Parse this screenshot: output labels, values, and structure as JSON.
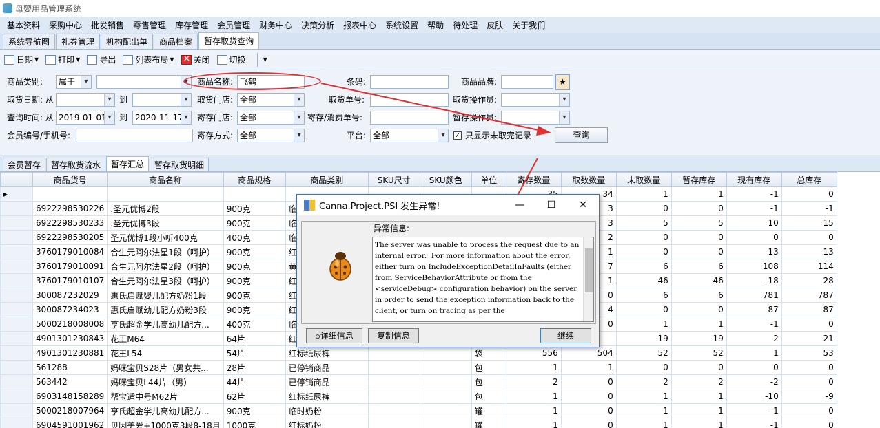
{
  "app_title": "母婴用品管理系统",
  "menu": [
    "基本资料",
    "采购中心",
    "批发销售",
    "零售管理",
    "库存管理",
    "会员管理",
    "财务中心",
    "决策分析",
    "报表中心",
    "系统设置",
    "帮助",
    "待处理",
    "皮肤",
    "关于我们"
  ],
  "doc_tabs": [
    "系统导航图",
    "礼券管理",
    "机构配出单",
    "商品档案",
    "暂存取货查询"
  ],
  "toolbar": {
    "date": "日期",
    "print": "打印",
    "export": "导出",
    "layout": "列表布局",
    "close": "关闭",
    "switch": "切换"
  },
  "filter": {
    "category_label": "商品类别:",
    "category_op": "属于",
    "category_value": "",
    "name_label": "商品名称:",
    "name_value": "飞鹤",
    "barcode_label": "条码:",
    "barcode_value": "",
    "brand_label": "商品品牌:",
    "brand_value": "",
    "pickup_date_label": "取货日期: 从",
    "pickup_from": "",
    "to1": "到",
    "pickup_to": "",
    "pickup_store_label": "取货门店:",
    "pickup_store": "全部",
    "pickup_no_label": "取货单号:",
    "pickup_no": "",
    "pickup_op_label": "取货操作员:",
    "pickup_op": "",
    "query_time_label": "查询时间: 从",
    "query_from": "2019-01-01",
    "to2": "到",
    "query_to": "2020-11-17",
    "deposit_store_label": "寄存门店:",
    "deposit_store": "全部",
    "deposit_no_label": "寄存/消费单号:",
    "deposit_no": "",
    "temp_op_label": "暂存操作员:",
    "temp_op": "",
    "member_label": "会员编号/手机号:",
    "member_value": "",
    "deposit_mode_label": "寄存方式:",
    "deposit_mode": "全部",
    "platform_label": "平台:",
    "platform": "全部",
    "only_unfinished_label": "只显示未取完记录",
    "only_unfinished_checked": true,
    "query_button": "查询"
  },
  "sub_tabs": [
    "会员暂存",
    "暂存取货流水",
    "暂存汇总",
    "暂存取货明细"
  ],
  "table": {
    "columns": [
      "商品货号",
      "商品名称",
      "商品规格",
      "商品类别",
      "SKU尺寸",
      "SKU颜色",
      "单位",
      "寄存数量",
      "取数数量",
      "未取数量",
      "暂存库存",
      "现有库存",
      "总库存"
    ],
    "summary": [
      "",
      "",
      "",
      "",
      "",
      "",
      "",
      "35",
      "34",
      "1",
      "1",
      "-1",
      "0"
    ],
    "rows": [
      [
        "6922298530226",
        ".圣元优博2段",
        "900克",
        "临时奶",
        "",
        "",
        "",
        "",
        "3",
        "0",
        "0",
        "-1",
        "-1"
      ],
      [
        "6922298530233",
        ".圣元优博3段",
        "900克",
        "临时奶",
        "",
        "",
        "",
        "",
        "3",
        "5",
        "5",
        "10",
        "15"
      ],
      [
        "6922298530205",
        "圣元优博1段小听400克",
        "400克",
        "临时奶",
        "",
        "",
        "",
        "",
        "2",
        "0",
        "0",
        "0",
        "0"
      ],
      [
        "3760179010084",
        "合生元阿尔法星1段（呵护）",
        "900克",
        "红标奶",
        "",
        "",
        "",
        "",
        "1",
        "0",
        "0",
        "13",
        "13"
      ],
      [
        "3760179010091",
        "合生元阿尔法星2段（呵护）",
        "900克",
        "黄标奶",
        "",
        "",
        "",
        "",
        "7",
        "6",
        "6",
        "108",
        "114"
      ],
      [
        "3760179010107",
        "合生元阿尔法星3段（呵护）",
        "900克",
        "红标奶",
        "",
        "",
        "",
        "",
        "1",
        "46",
        "46",
        "-18",
        "28"
      ],
      [
        "300087232029",
        "惠氏启赋婴儿配方奶粉1段",
        "900克",
        "红标奶",
        "",
        "",
        "",
        "",
        "0",
        "6",
        "6",
        "781",
        "787"
      ],
      [
        "300087234023",
        "惠氏启赋幼儿配方奶粉3段",
        "900克",
        "红标奶",
        "",
        "",
        "",
        "",
        "4",
        "0",
        "0",
        "87",
        "87"
      ],
      [
        "5000218008008",
        "亨氏超金学儿高幼儿配方...",
        "400克",
        "临时奶",
        "",
        "",
        "",
        "",
        "0",
        "1",
        "1",
        "-1",
        "0"
      ],
      [
        "4901301230843",
        "花王M64",
        "64片",
        "红标纸",
        "",
        "",
        "",
        "",
        "",
        "19",
        "19",
        "2",
        "21"
      ],
      [
        "4901301230881",
        "花王L54",
        "54片",
        "红标纸尿裤",
        "",
        "",
        "袋",
        "556",
        "504",
        "52",
        "52",
        "1",
        "53"
      ],
      [
        "561288",
        "妈咪宝贝S28片（男女共...",
        "28片",
        "已停销商品",
        "",
        "",
        "包",
        "1",
        "1",
        "0",
        "0",
        "0",
        "0"
      ],
      [
        "563442",
        "妈咪宝贝L44片（男）",
        "44片",
        "已停销商品",
        "",
        "",
        "包",
        "2",
        "0",
        "2",
        "2",
        "-2",
        "0"
      ],
      [
        "6903148158289",
        "帮宝适中号M62片",
        "62片",
        "红标纸尿裤",
        "",
        "",
        "包",
        "1",
        "0",
        "1",
        "1",
        "-10",
        "-9"
      ],
      [
        "5000218007964",
        "亨氏超金学儿高幼儿配方...",
        "900克",
        "临时奶粉",
        "",
        "",
        "罐",
        "1",
        "0",
        "1",
        "1",
        "-1",
        "0"
      ],
      [
        "6904591001962",
        "贝因美爱+1000克3段8-18月",
        "1000克",
        "红标奶粉",
        "",
        "",
        "罐",
        "1",
        "0",
        "1",
        "1",
        "-1",
        "0"
      ]
    ]
  },
  "dialog": {
    "title": "Canna.Project.PSI 发生异常!",
    "error_label": "异常信息:",
    "error_text": "The server was unable to process the request due to an internal error.  For more information about the error, either turn on IncludeExceptionDetailInFaults (either from ServiceBehaviorAttribute or from the <serviceDebug> configuration behavior) on the server in order to send the exception information back to the client, or turn on tracing as per the",
    "details_button": "详细信息",
    "copy_button": "复制信息",
    "continue_button": "继续"
  },
  "colors": {
    "annotation": "#e03030",
    "header_bg": "#e3eaf4",
    "dialog_border": "#4a6fa8"
  }
}
